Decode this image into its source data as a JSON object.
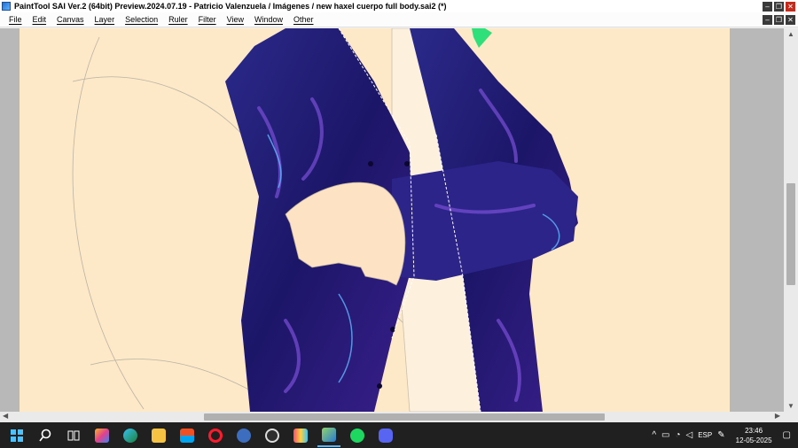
{
  "window": {
    "title": "PaintTool SAI Ver.2 (64bit) Preview.2024.07.19 - Patricio Valenzuela / Imágenes / new haxel cuerpo full body.sai2 (*)"
  },
  "menu": {
    "items": [
      "File",
      "Edit",
      "Canvas",
      "Layer",
      "Selection",
      "Ruler",
      "Filter",
      "View",
      "Window",
      "Other"
    ]
  },
  "canvas": {
    "background_color": "#fde8c8",
    "jacket_color": "#2a1d7a"
  },
  "scrollbars": {
    "up_arrow": "▲",
    "down_arrow": "▼",
    "left_arrow": "◀",
    "right_arrow": "▶"
  },
  "taskbar": {
    "icons": [
      "windows-start",
      "search",
      "task-view",
      "copilot",
      "edge",
      "file-explorer",
      "microsoft-store",
      "opera",
      "qbittorrent",
      "obs",
      "ibis-paint",
      "painttool-sai",
      "spotify",
      "discord"
    ],
    "tray": {
      "chevron": "^",
      "language": "ESP",
      "time": "23:46",
      "date": "12-05-2025"
    }
  }
}
